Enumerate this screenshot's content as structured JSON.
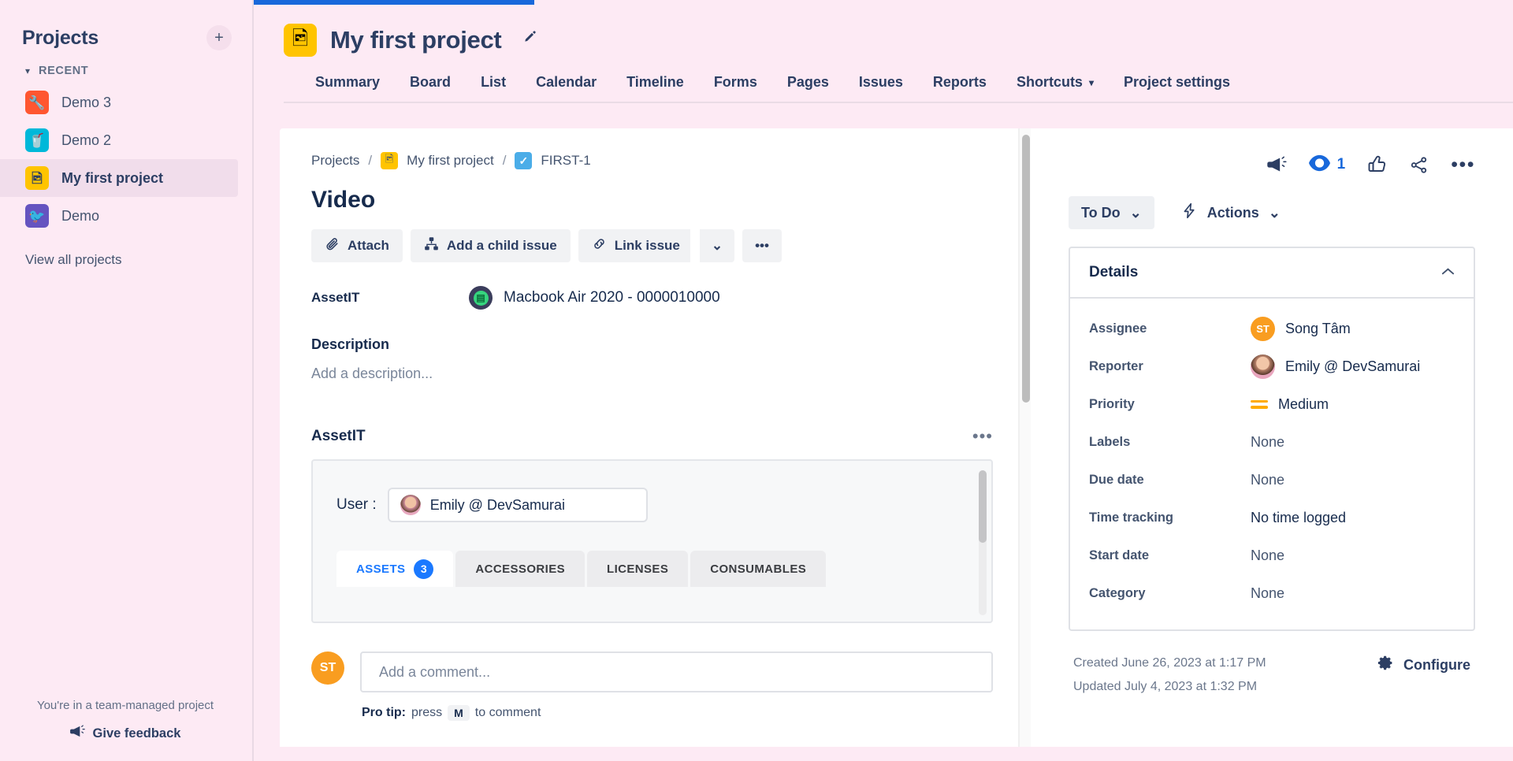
{
  "sidebar": {
    "title": "Projects",
    "add_label": "+",
    "section_label": "RECENT",
    "items": [
      {
        "label": "Demo 3",
        "icon": "wrench-icon",
        "glyph": "🔧",
        "active": false
      },
      {
        "label": "Demo 2",
        "icon": "coffee-cup-icon",
        "glyph": "🥤",
        "active": false
      },
      {
        "label": "My first project",
        "icon": "photo-icon",
        "glyph": "🖼",
        "active": true
      },
      {
        "label": "Demo",
        "icon": "bird-icon",
        "glyph": "🐦",
        "active": false
      }
    ],
    "view_all": "View all projects",
    "team_managed_note": "You're in a team-managed project",
    "give_feedback": "Give feedback"
  },
  "project_header": {
    "title": "My first project",
    "icon": "photo-icon",
    "glyph": "🖼",
    "edit_icon": "pen-icon"
  },
  "tabs": [
    {
      "label": "Summary"
    },
    {
      "label": "Board"
    },
    {
      "label": "List"
    },
    {
      "label": "Calendar"
    },
    {
      "label": "Timeline"
    },
    {
      "label": "Forms"
    },
    {
      "label": "Pages"
    },
    {
      "label": "Issues"
    },
    {
      "label": "Reports"
    },
    {
      "label": "Shortcuts",
      "caret": "⌄"
    },
    {
      "label": "Project settings"
    }
  ],
  "issue": {
    "breadcrumb": {
      "projects": "Projects",
      "project": "My first project",
      "key": "FIRST-1",
      "task_check": "✓"
    },
    "title": "Video",
    "actions": {
      "attach": "Attach",
      "add_child": "Add a child issue",
      "link_issue": "Link issue",
      "caret": "⌄",
      "more": "•••"
    },
    "asset_field": {
      "label": "AssetIT",
      "value": "Macbook Air 2020 - 0000010000"
    },
    "description": {
      "heading": "Description",
      "placeholder": "Add a description..."
    },
    "asset_panel": {
      "heading": "AssetIT",
      "more": "•••",
      "user_label": "User :",
      "user_value": "Emily @ DevSamurai",
      "tabs": [
        {
          "label": "ASSETS",
          "badge": "3",
          "active": true
        },
        {
          "label": "ACCESSORIES",
          "badge": "",
          "active": false
        },
        {
          "label": "LICENSES",
          "badge": "",
          "active": false
        },
        {
          "label": "CONSUMABLES",
          "badge": "",
          "active": false
        }
      ]
    },
    "comment": {
      "avatar_initials": "ST",
      "placeholder": "Add a comment...",
      "tip_prefix": "Pro tip:",
      "tip_mid": "press",
      "tip_key": "M",
      "tip_suffix": "to comment"
    }
  },
  "right_panel": {
    "tools": {
      "announce_icon": "megaphone-icon",
      "watch_icon": "eye-icon",
      "watch_count": "1",
      "like_icon": "thumbs-up-icon",
      "share_icon": "share-icon",
      "more_icon": "•••"
    },
    "status": "To Do",
    "status_caret": "⌄",
    "actions_label": "Actions",
    "actions_caret": "⌄",
    "details": {
      "heading": "Details",
      "collapse": "⌃",
      "fields": [
        {
          "label": "Assignee",
          "value": "Song Tâm",
          "avatar": "ST",
          "kind": "avatar-st"
        },
        {
          "label": "Reporter",
          "value": "Emily @ DevSamurai",
          "kind": "avatar-photo"
        },
        {
          "label": "Priority",
          "value": "Medium",
          "kind": "priority-medium"
        },
        {
          "label": "Labels",
          "value": "None",
          "kind": "none"
        },
        {
          "label": "Due date",
          "value": "None",
          "kind": "none"
        },
        {
          "label": "Time tracking",
          "value": "No time logged",
          "kind": "plain"
        },
        {
          "label": "Start date",
          "value": "None",
          "kind": "none"
        },
        {
          "label": "Category",
          "value": "None",
          "kind": "none"
        }
      ]
    },
    "created": "Created June 26, 2023 at 1:17 PM",
    "updated": "Updated July 4, 2023 at 1:32 PM",
    "configure": "Configure"
  },
  "colors": {
    "page_bg": "#fdeaf4",
    "accent_blue": "#1868db",
    "tab_active_blue": "#1b79ff",
    "priority_orange": "#ffab00",
    "avatar_orange": "#f99d20"
  }
}
